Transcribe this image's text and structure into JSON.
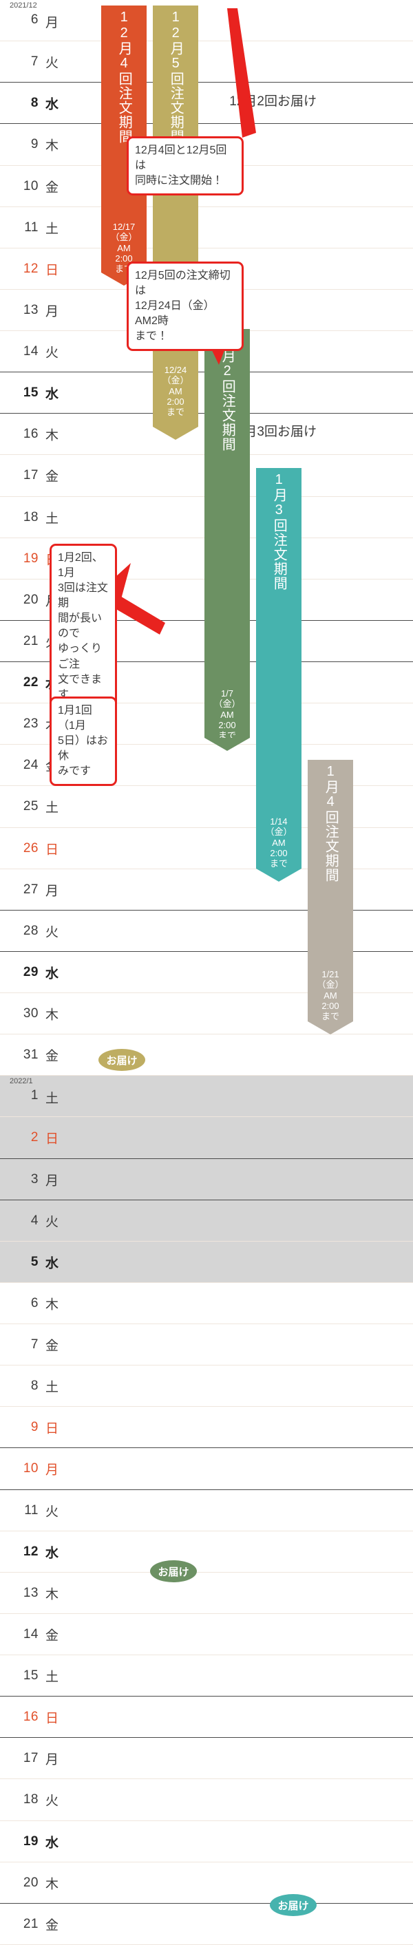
{
  "calendar": {
    "month_labels": {
      "dec": "2021/12",
      "jan": "2022/1"
    },
    "rows": [
      {
        "day": "6",
        "wd": "月",
        "month": "2021/12",
        "kind": "mon"
      },
      {
        "day": "7",
        "wd": "火",
        "kind": "tue"
      },
      {
        "day": "8",
        "wd": "水",
        "kind": "wed"
      },
      {
        "day": "9",
        "wd": "木",
        "kind": "thu"
      },
      {
        "day": "10",
        "wd": "金",
        "kind": "fri"
      },
      {
        "day": "11",
        "wd": "土",
        "kind": "sat"
      },
      {
        "day": "12",
        "wd": "日",
        "kind": "sun"
      },
      {
        "day": "13",
        "wd": "月",
        "kind": "mon"
      },
      {
        "day": "14",
        "wd": "火",
        "kind": "tue"
      },
      {
        "day": "15",
        "wd": "水",
        "kind": "wed"
      },
      {
        "day": "16",
        "wd": "木",
        "kind": "thu"
      },
      {
        "day": "17",
        "wd": "金",
        "kind": "fri"
      },
      {
        "day": "18",
        "wd": "土",
        "kind": "sat"
      },
      {
        "day": "19",
        "wd": "日",
        "kind": "sun"
      },
      {
        "day": "20",
        "wd": "月",
        "kind": "mon"
      },
      {
        "day": "21",
        "wd": "火",
        "kind": "tue"
      },
      {
        "day": "22",
        "wd": "水",
        "kind": "wed"
      },
      {
        "day": "23",
        "wd": "木",
        "kind": "thu"
      },
      {
        "day": "24",
        "wd": "金",
        "kind": "fri"
      },
      {
        "day": "25",
        "wd": "土",
        "kind": "sat"
      },
      {
        "day": "26",
        "wd": "日",
        "kind": "sun"
      },
      {
        "day": "27",
        "wd": "月",
        "kind": "mon"
      },
      {
        "day": "28",
        "wd": "火",
        "kind": "tue"
      },
      {
        "day": "29",
        "wd": "水",
        "kind": "wed"
      },
      {
        "day": "30",
        "wd": "木",
        "kind": "thu"
      },
      {
        "day": "31",
        "wd": "金",
        "kind": "fri"
      },
      {
        "day": "1",
        "wd": "土",
        "month": "2022/1",
        "kind": "sat",
        "shaded": true
      },
      {
        "day": "2",
        "wd": "日",
        "kind": "sun",
        "shaded": true
      },
      {
        "day": "3",
        "wd": "月",
        "kind": "mon",
        "shaded": true
      },
      {
        "day": "4",
        "wd": "火",
        "kind": "tue",
        "shaded": true
      },
      {
        "day": "5",
        "wd": "水",
        "kind": "wed",
        "shaded": true
      },
      {
        "day": "6",
        "wd": "木",
        "kind": "thu"
      },
      {
        "day": "7",
        "wd": "金",
        "kind": "fri"
      },
      {
        "day": "8",
        "wd": "土",
        "kind": "sat"
      },
      {
        "day": "9",
        "wd": "日",
        "kind": "sun"
      },
      {
        "day": "10",
        "wd": "月",
        "kind": "sun"
      },
      {
        "day": "11",
        "wd": "火",
        "kind": "tue"
      },
      {
        "day": "12",
        "wd": "水",
        "kind": "wed"
      },
      {
        "day": "13",
        "wd": "木",
        "kind": "thu"
      },
      {
        "day": "14",
        "wd": "金",
        "kind": "fri"
      },
      {
        "day": "15",
        "wd": "土",
        "kind": "sat"
      },
      {
        "day": "16",
        "wd": "日",
        "kind": "sun"
      },
      {
        "day": "17",
        "wd": "月",
        "kind": "mon"
      },
      {
        "day": "18",
        "wd": "火",
        "kind": "tue"
      },
      {
        "day": "19",
        "wd": "水",
        "kind": "wed"
      },
      {
        "day": "20",
        "wd": "木",
        "kind": "thu"
      },
      {
        "day": "21",
        "wd": "金",
        "kind": "fri"
      }
    ]
  },
  "bars": [
    {
      "id": "dec4",
      "title": "12月4回注文期間",
      "color": "#dd522b",
      "deadline": "12/17\n（金）\nAM\n2:00\nまで"
    },
    {
      "id": "dec5",
      "title": "12月5回注文期間",
      "color": "#bead62",
      "deadline": "12/24\n（金）\nAM\n2:00\nまで"
    },
    {
      "id": "jan2",
      "title": "1月2回注文期間",
      "color": "#6c9163",
      "deadline": "1/7\n（金）\nAM\n2:00\nまで"
    },
    {
      "id": "jan3",
      "title": "1月3回注文期間",
      "color": "#46b3ae",
      "deadline": "1/14\n（金）\nAM\n2:00\nまで"
    },
    {
      "id": "jan4",
      "title": "1月4回注文期間",
      "color": "#b8b0a4",
      "deadline": "1/21\n（金）\nAM\n2:00\nまで"
    }
  ],
  "deliveries": [
    {
      "id": "dec2",
      "label": "12月2回お届け"
    },
    {
      "id": "dec3",
      "label": "12月3回お届け"
    }
  ],
  "pills": [
    {
      "id": "dec4-deliver",
      "label": "お届け",
      "color": "#dd522b"
    },
    {
      "id": "dec5-deliver",
      "label": "お届け",
      "color": "#bead62"
    },
    {
      "id": "jan2-deliver",
      "label": "お届け",
      "color": "#6c9163"
    },
    {
      "id": "jan3-deliver",
      "label": "お届け",
      "color": "#46b3ae"
    }
  ],
  "callouts": [
    {
      "id": "c1",
      "line1": "12月4回と12月5回は",
      "line2": "同時に注文開始！"
    },
    {
      "id": "c2",
      "line1": "12月5回の注文締切は",
      "line2": "12月24日（金）AM2時",
      "line3": "まで！"
    },
    {
      "id": "c3",
      "line1": "1月2回、1月",
      "line2": "3回は注文期",
      "line3": "間が長いので",
      "line4": "ゆっくりご注",
      "line5": "文できます"
    },
    {
      "id": "c4",
      "line1": "1月1回（1月",
      "line2": "5日）はお休",
      "line3": "みです"
    }
  ],
  "colors": {
    "accent_red": "#e8231f",
    "dec4": "#dd522b",
    "dec5": "#bead62",
    "jan2": "#6c9163",
    "jan3": "#46b3ae",
    "jan4": "#b8b0a4",
    "shaded_row": "#d5d5d5",
    "text": "#3c3c3c",
    "sunday": "#e1502a"
  }
}
